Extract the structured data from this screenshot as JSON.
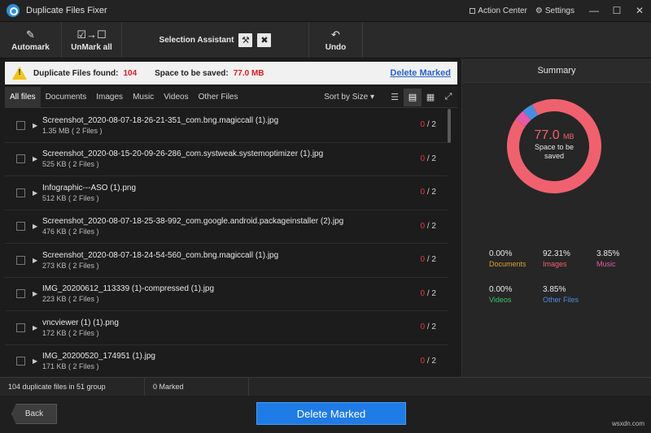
{
  "titlebar": {
    "title": "Duplicate Files Fixer",
    "action_center": "Action Center",
    "settings": "Settings"
  },
  "toolbar": {
    "automark": "Automark",
    "unmark_all": "UnMark all",
    "selection_assistant": "Selection Assistant",
    "undo": "Undo"
  },
  "info": {
    "found_label": "Duplicate Files found:",
    "found_value": "104",
    "space_label": "Space to be saved:",
    "space_value": "77.0 MB",
    "delete_link": "Delete Marked"
  },
  "tabs": [
    "All files",
    "Documents",
    "Images",
    "Music",
    "Videos",
    "Other Files"
  ],
  "sort_label": "Sort by Size",
  "files": [
    {
      "name": "Screenshot_2020-08-07-18-26-21-351_com.bng.magiccall (1).jpg",
      "meta": "1.35 MB  ( 2 Files )",
      "marked": "0",
      "total": "/ 2"
    },
    {
      "name": "Screenshot_2020-08-15-20-09-26-286_com.systweak.systemoptimizer (1).jpg",
      "meta": "525 KB  ( 2 Files )",
      "marked": "0",
      "total": "/ 2"
    },
    {
      "name": "Infographic---ASO (1).png",
      "meta": "512 KB  ( 2 Files )",
      "marked": "0",
      "total": "/ 2"
    },
    {
      "name": "Screenshot_2020-08-07-18-25-38-992_com.google.android.packageinstaller (2).jpg",
      "meta": "476 KB  ( 2 Files )",
      "marked": "0",
      "total": "/ 2"
    },
    {
      "name": "Screenshot_2020-08-07-18-24-54-560_com.bng.magiccall (1).jpg",
      "meta": "273 KB  ( 2 Files )",
      "marked": "0",
      "total": "/ 2"
    },
    {
      "name": "IMG_20200612_113339 (1)-compressed (1).jpg",
      "meta": "223 KB  ( 2 Files )",
      "marked": "0",
      "total": "/ 2"
    },
    {
      "name": "vncviewer (1) (1).png",
      "meta": "172 KB  ( 2 Files )",
      "marked": "0",
      "total": "/ 2"
    },
    {
      "name": "IMG_20200520_174951 (1).jpg",
      "meta": "171 KB  ( 2 Files )",
      "marked": "0",
      "total": "/ 2"
    }
  ],
  "summary": {
    "title": "Summary",
    "center_value": "77.0",
    "center_unit": "MB",
    "center_label_1": "Space to be",
    "center_label_2": "saved",
    "legend": [
      {
        "pct": "0.00%",
        "name": "Documents",
        "value": 0.0,
        "color": "#e0a02a"
      },
      {
        "pct": "92.31%",
        "name": "Images",
        "value": 92.31,
        "color": "#f0616f"
      },
      {
        "pct": "3.85%",
        "name": "Music",
        "value": 3.85,
        "color": "#e45aa8"
      },
      {
        "pct": "0.00%",
        "name": "Videos",
        "value": 0.0,
        "color": "#37c46a"
      },
      {
        "pct": "3.85%",
        "name": "Other Files",
        "value": 3.85,
        "color": "#4a8de0"
      }
    ]
  },
  "status": {
    "groups": "104 duplicate files in 51 group",
    "marked": "0 Marked"
  },
  "bottom": {
    "back": "Back",
    "delete": "Delete Marked",
    "watermark": "wsxdn.com"
  }
}
